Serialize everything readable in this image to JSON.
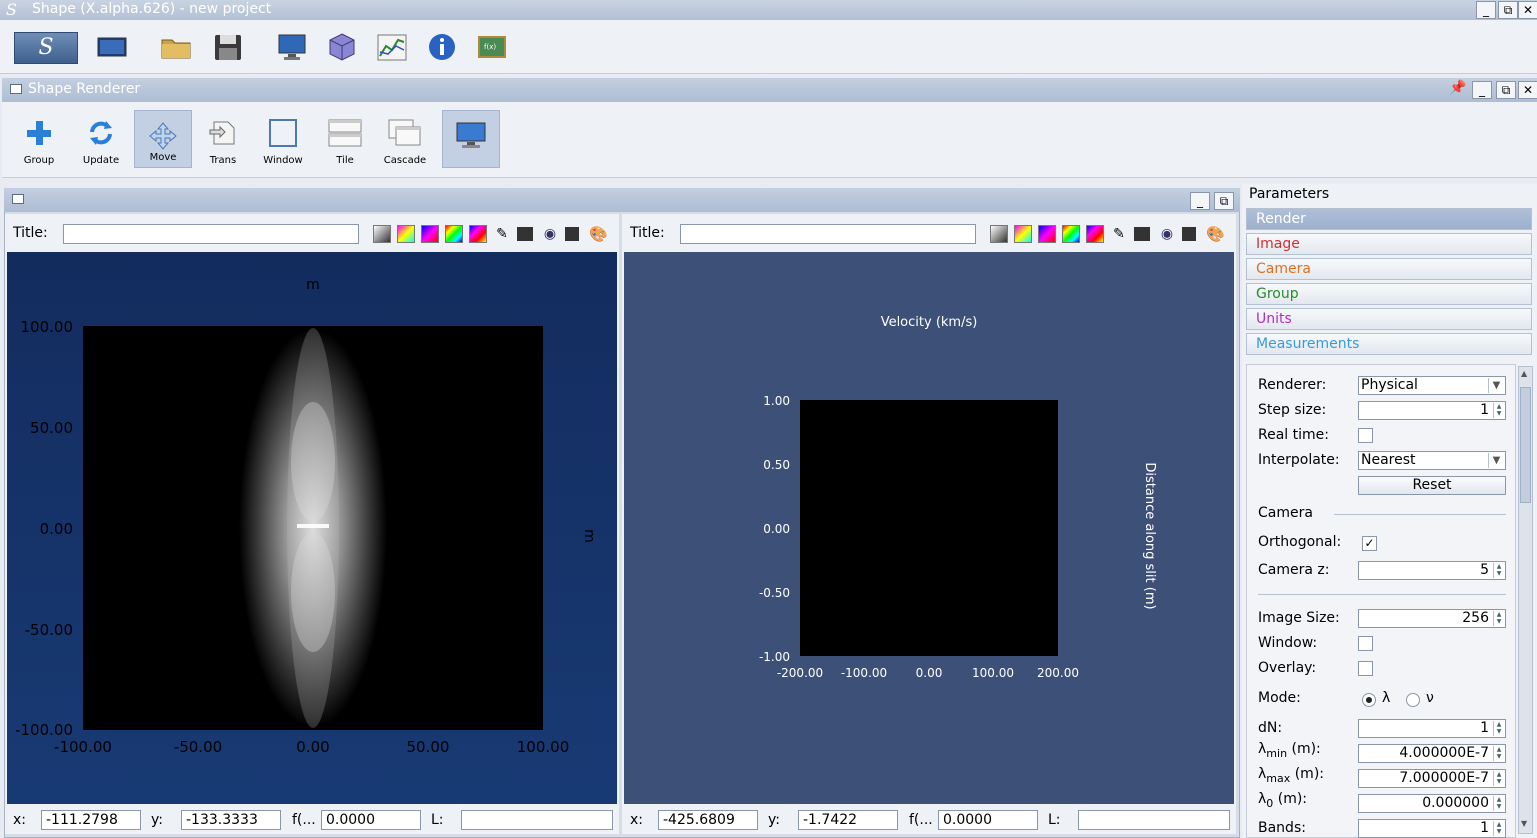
{
  "window": {
    "logo": "S",
    "title": "Shape (X.alpha.626) - new project",
    "minimize": "_",
    "maximize": "⧉",
    "close": "✕"
  },
  "main_toolbar": {
    "icons": [
      "shape-logo-icon",
      "image-icon",
      "folder-open-icon",
      "save-icon",
      "monitor-icon",
      "cube-icon",
      "graph-icon",
      "info-icon",
      "chalkboard-icon"
    ]
  },
  "renderer": {
    "title": "Shape Renderer",
    "toolbar": {
      "group": "Group",
      "update": "Update",
      "move": "Move",
      "trans": "Trans",
      "window": "Window",
      "tile": "Tile",
      "cascade": "Cascade"
    }
  },
  "left_panel": {
    "title_label": "Title:",
    "title_value": "",
    "plot": {
      "top_label": "m",
      "right_label": "m",
      "yticks": [
        "100.00",
        "50.00",
        "0.00",
        "-50.00",
        "-100.00"
      ],
      "xticks": [
        "-100.00",
        "-50.00",
        "0.00",
        "50.00",
        "100.00"
      ]
    },
    "status": {
      "x_label": "x:",
      "x_value": "-111.2798",
      "y_label": "y:",
      "y_value": "-133.3333",
      "f_label": "f(...",
      "f_value": "0.0000",
      "l_label": "L:",
      "l_value": ""
    }
  },
  "right_panel": {
    "title_label": "Title:",
    "title_value": "",
    "plot": {
      "top_label": "Velocity (km/s)",
      "right_label": "Distance along slit (m)",
      "yticks": [
        "1.00",
        "0.50",
        "0.00",
        "-0.50",
        "-1.00"
      ],
      "xticks": [
        "-200.00",
        "-100.00",
        "0.00",
        "100.00",
        "200.00"
      ]
    },
    "status": {
      "x_label": "x:",
      "x_value": "-425.6809",
      "y_label": "y:",
      "y_value": "-1.7422",
      "f_label": "f(...",
      "f_value": "0.0000",
      "l_label": "L:",
      "l_value": ""
    }
  },
  "parameters": {
    "header": "Parameters",
    "tabs": [
      {
        "label": "Render",
        "color": "#ffffff"
      },
      {
        "label": "Image",
        "color": "#d03030"
      },
      {
        "label": "Camera",
        "color": "#e07020"
      },
      {
        "label": "Group",
        "color": "#2a8a2a"
      },
      {
        "label": "Units",
        "color": "#b030c0"
      },
      {
        "label": "Measurements",
        "color": "#3a9ad8"
      }
    ],
    "renderer_label": "Renderer:",
    "renderer_value": "Physical",
    "step_label": "Step size:",
    "step_value": "1",
    "realtime_label": "Real time:",
    "interp_label": "Interpolate:",
    "interp_value": "Nearest",
    "reset_label": "Reset",
    "camera_section": "Camera",
    "ortho_label": "Orthogonal:",
    "camz_label": "Camera z:",
    "camz_value": "5",
    "imgsize_label": "Image Size:",
    "imgsize_value": "256",
    "window_label": "Window:",
    "overlay_label": "Overlay:",
    "mode_label": "Mode:",
    "mode_lambda": "λ",
    "mode_nu": "ν",
    "dn_label": "dN:",
    "dn_value": "1",
    "lmin_label": "λ",
    "lmin_sub": "min",
    "lmin_unit": " (m):",
    "lmin_value": "4.000000E-7",
    "lmax_label": "λ",
    "lmax_sub": "max",
    "lmax_unit": " (m):",
    "lmax_value": "7.000000E-7",
    "l0_label": "λ",
    "l0_sub": "0",
    "l0_unit": " (m):",
    "l0_value": "0.000000",
    "bands_label": "Bands:",
    "bands_value": "1"
  }
}
